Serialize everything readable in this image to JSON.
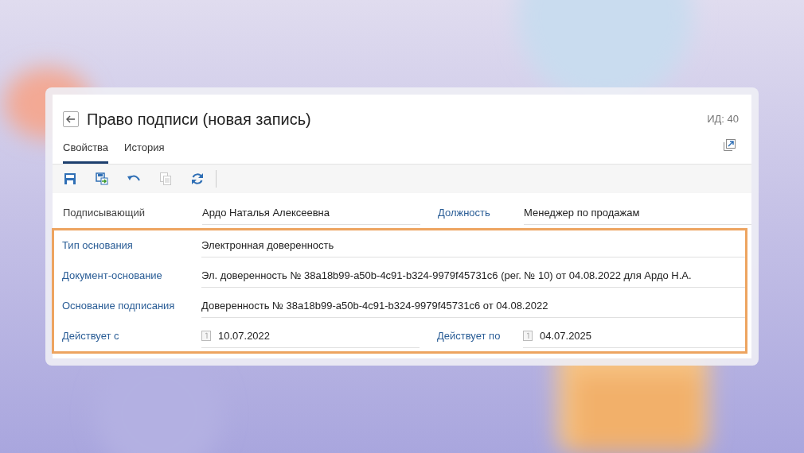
{
  "window": {
    "title": "Право подписи (новая запись)",
    "id_label": "ИД: 40"
  },
  "tabs": [
    {
      "label": "Свойства",
      "selected": true
    },
    {
      "label": "История",
      "selected": false
    }
  ],
  "toolbar": [
    {
      "kind": "save",
      "disabled": false
    },
    {
      "kind": "save-new",
      "disabled": false
    },
    {
      "kind": "undo",
      "disabled": false
    },
    {
      "kind": "copy",
      "disabled": true
    },
    {
      "kind": "refresh",
      "disabled": false
    }
  ],
  "groups": [
    {
      "highlighted": false,
      "rows": [
        {
          "fields": [
            {
              "label": {
                "text": "Подписывающий",
                "kind": "plain"
              },
              "kind": "text",
              "value": "Ардо Наталья Алексеевна"
            },
            {
              "label": {
                "text": "Должность",
                "kind": "link"
              },
              "kind": "text",
              "value": "Менеджер по продажам"
            }
          ]
        }
      ]
    },
    {
      "highlighted": true,
      "rows": [
        {
          "fields": [
            {
              "label": {
                "text": "Тип основания",
                "kind": "link"
              },
              "kind": "text",
              "value": "Электронная доверенность"
            }
          ]
        },
        {
          "fields": [
            {
              "label": {
                "text": "Документ-основание",
                "kind": "link"
              },
              "kind": "text",
              "value": "Эл. доверенность № 38a18b99-a50b-4c91-b324-9979f45731c6 (рег. № 10) от 04.08.2022 для Ардо Н.А."
            }
          ]
        },
        {
          "fields": [
            {
              "label": {
                "text": "Основание подписания",
                "kind": "link"
              },
              "kind": "text",
              "value": "Доверенность № 38a18b99-a50b-4c91-b324-9979f45731c6 от 04.08.2022"
            }
          ]
        },
        {
          "fields": [
            {
              "label": {
                "text": "Действует с",
                "kind": "link"
              },
              "kind": "date",
              "value": "10.07.2022"
            },
            {
              "label": {
                "text": "Действует по",
                "kind": "link"
              },
              "kind": "date",
              "value": "04.07.2025"
            }
          ]
        }
      ]
    }
  ]
}
